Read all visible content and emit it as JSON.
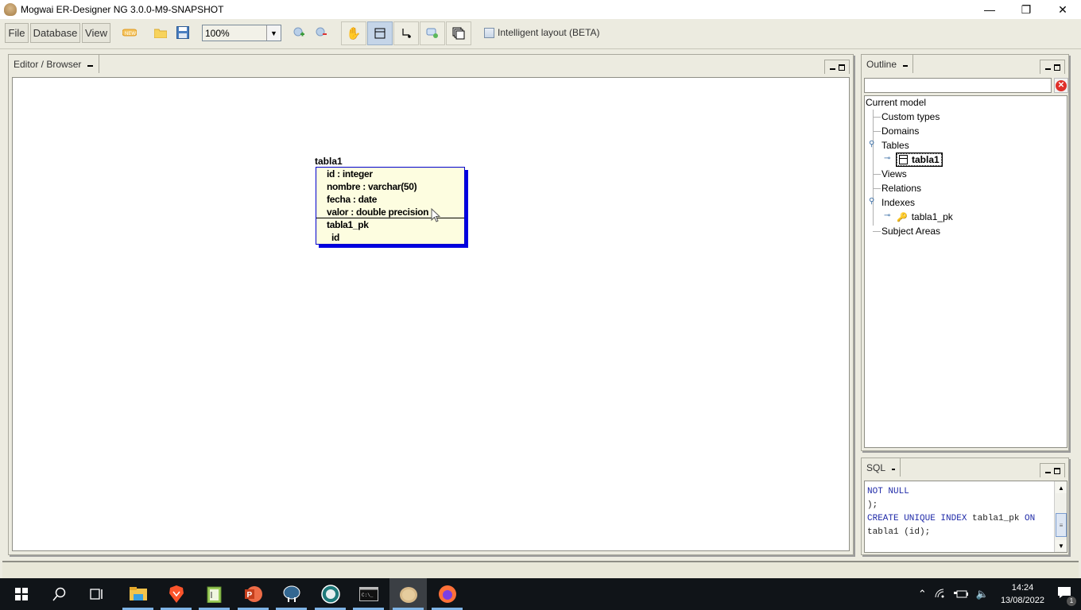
{
  "window": {
    "title": "Mogwai ER-Designer NG 3.0.0-M9-SNAPSHOT",
    "controls": {
      "minimize": "—",
      "restore": "❐",
      "close": "✕"
    }
  },
  "toolbar": {
    "menus": [
      {
        "label": "File"
      },
      {
        "label": "Database"
      },
      {
        "label": "View"
      }
    ],
    "icons": [
      "new-model-icon",
      "open-folder-icon",
      "save-icon"
    ],
    "zoom": {
      "value": "100%"
    },
    "zoom_icons": [
      "zoom-in-icon",
      "zoom-out-icon"
    ],
    "tools": [
      {
        "name": "hand-tool",
        "glyph": "✋",
        "active": false
      },
      {
        "name": "entity-tool",
        "glyph": "▭",
        "active": true
      },
      {
        "name": "relation-tool",
        "glyph": "↳",
        "active": false
      },
      {
        "name": "comment-tool",
        "glyph": "💬",
        "active": false
      },
      {
        "name": "subject-area-tool",
        "glyph": "⧉",
        "active": false
      }
    ],
    "intelligent_layout": {
      "label": "Intelligent layout (BETA)",
      "checked": false
    }
  },
  "editor": {
    "tab_label": "Editor / Browser",
    "entity": {
      "name": "tabla1",
      "attributes": [
        "id : integer",
        "nombre : varchar(50)",
        "fecha : date",
        "valor : double precision"
      ],
      "index_name": "tabla1_pk",
      "index_columns": [
        "id"
      ]
    }
  },
  "outline": {
    "tab_label": "Outline",
    "search": {
      "value": "",
      "placeholder": ""
    },
    "root": "Current model",
    "items": [
      {
        "label": "Custom types"
      },
      {
        "label": "Domains"
      },
      {
        "label": "Tables",
        "expanded": true,
        "children": [
          {
            "label": "tabla1",
            "selected": true
          }
        ]
      },
      {
        "label": "Views"
      },
      {
        "label": "Relations"
      },
      {
        "label": "Indexes",
        "expanded": true,
        "children": [
          {
            "label": "tabla1_pk"
          }
        ]
      },
      {
        "label": "Subject Areas"
      }
    ]
  },
  "sql": {
    "tab_label": "SQL",
    "lines": [
      {
        "kw": "NOT NULL",
        "rest": ""
      },
      {
        "kw": "",
        "rest": ");"
      },
      {
        "kw": "CREATE UNIQUE INDEX",
        "rest": " tabla1_pk ",
        "kw2": "ON"
      },
      {
        "kw": "",
        "rest": "tabla1 (id);"
      }
    ]
  },
  "taskbar": {
    "apps": [
      {
        "name": "start",
        "glyph": "⊞"
      },
      {
        "name": "search",
        "glyph": "⚲"
      },
      {
        "name": "task-view",
        "glyph": "⧈"
      },
      {
        "name": "file-explorer",
        "glyph": "📁",
        "running": true
      },
      {
        "name": "brave-browser",
        "glyph": "🦁",
        "running": true
      },
      {
        "name": "notepad-plus",
        "glyph": "📝",
        "running": true
      },
      {
        "name": "powerpoint",
        "glyph": "P",
        "running": true
      },
      {
        "name": "pgadmin",
        "glyph": "🐘",
        "running": true
      },
      {
        "name": "app-circle",
        "glyph": "◉",
        "running": true
      },
      {
        "name": "terminal",
        "glyph": "▭",
        "running": true
      },
      {
        "name": "mogwai",
        "glyph": "●",
        "running": true,
        "current": true
      },
      {
        "name": "firefox",
        "glyph": "🦊",
        "running": true
      }
    ],
    "tray": {
      "time": "14:24",
      "date": "13/08/2022",
      "notifications": "1"
    }
  },
  "colors": {
    "entity_fill": "#fdfde0",
    "entity_border": "#0000cc",
    "sql_keyword": "#1f2aa8",
    "window_bg": "#ecebe0"
  }
}
